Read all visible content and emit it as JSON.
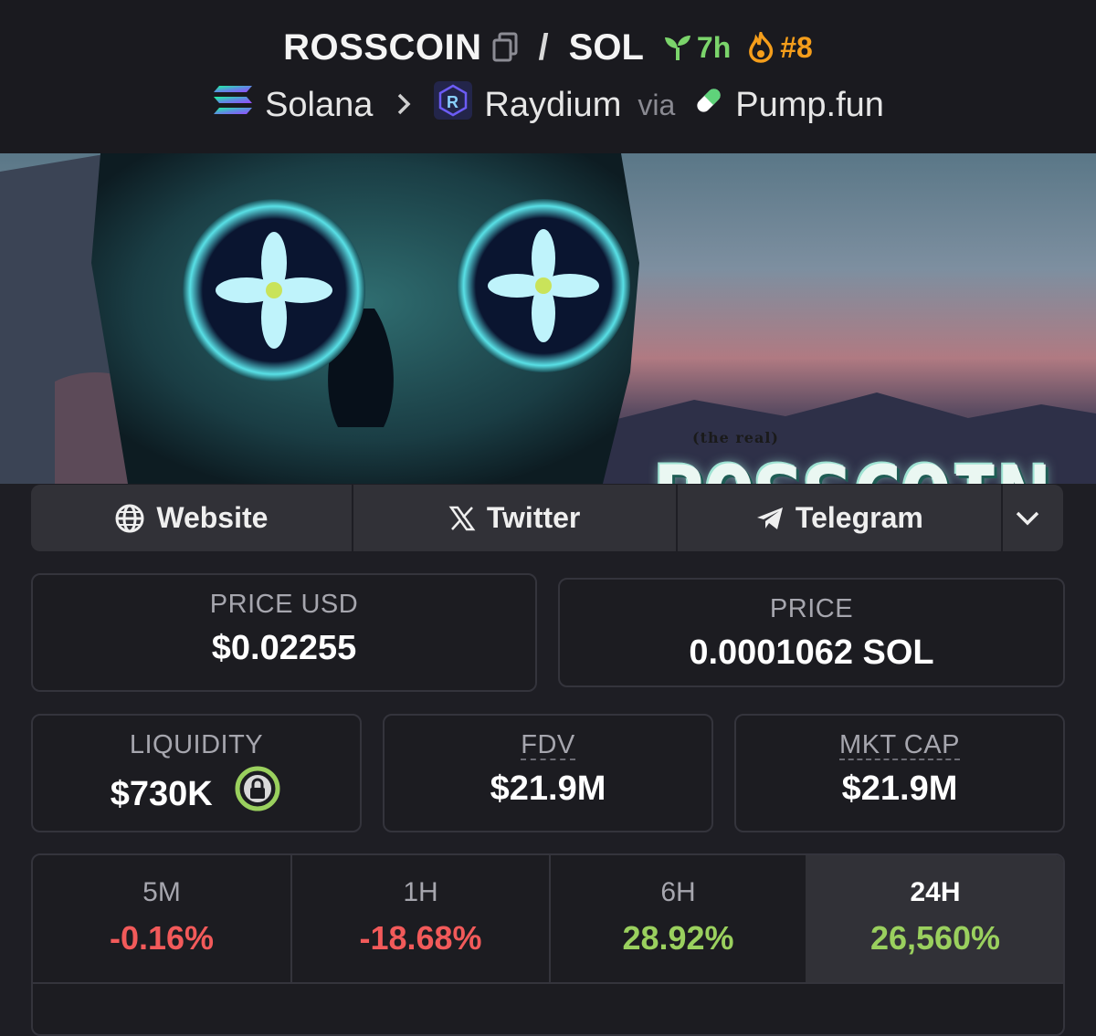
{
  "header": {
    "token": "ROSSCOIN",
    "separator": "/",
    "quote": "SOL",
    "age": "7h",
    "rank": "#8",
    "chain": "Solana",
    "dex": "Raydium",
    "via": "via",
    "launchpad": "Pump.fun"
  },
  "banner": {
    "small_text": "(the real)",
    "big_text": "ROSSCOIN"
  },
  "links": {
    "website": "Website",
    "twitter": "Twitter",
    "telegram": "Telegram"
  },
  "stats": {
    "price_usd_label": "PRICE USD",
    "price_usd": "$0.02255",
    "price_label": "PRICE",
    "price": "0.0001062 SOL",
    "liquidity_label": "LIQUIDITY",
    "liquidity": "$730K",
    "fdv_label": "FDV",
    "fdv": "$21.9M",
    "mkt_cap_label": "MKT CAP",
    "mkt_cap": "$21.9M"
  },
  "changes": [
    {
      "label": "5M",
      "value": "-0.16%"
    },
    {
      "label": "1H",
      "value": "-18.68%"
    },
    {
      "label": "6H",
      "value": "28.92%"
    },
    {
      "label": "24H",
      "value": "26,560%"
    }
  ],
  "colors": {
    "positive": "#9ad05e",
    "negative": "#f25a5a",
    "age": "#7bd46b",
    "rank": "#f59e1b",
    "lock": "#9ad05e"
  },
  "icons": {
    "copy": "copy-icon",
    "age": "seedling-icon",
    "rank": "flame-icon",
    "chain": "solana-logo-icon",
    "dex": "raydium-logo-icon",
    "launchpad": "pill-icon",
    "website": "globe-icon",
    "twitter": "x-icon",
    "telegram": "paper-plane-icon",
    "more": "chevron-down-icon",
    "lock": "lock-icon"
  }
}
